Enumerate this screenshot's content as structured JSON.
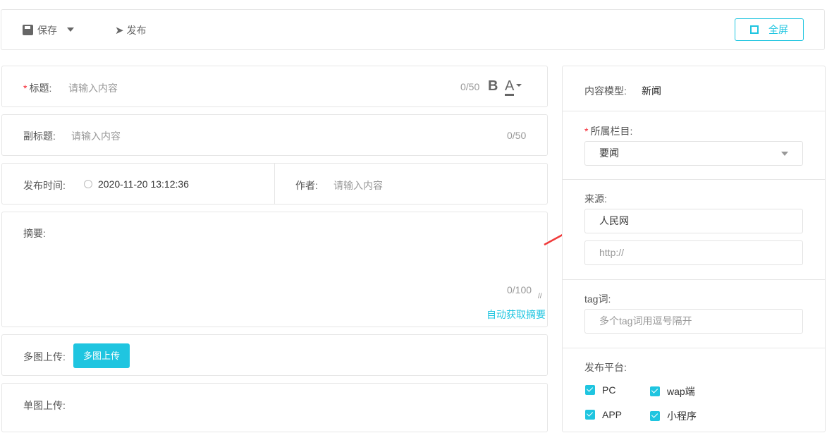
{
  "toolbar": {
    "save": "保存",
    "publish": "发布",
    "fullscreen": "全屏"
  },
  "title": {
    "label": "标题:",
    "placeholder": "请输入内容",
    "count": "0/50",
    "bold": "B",
    "color": "A"
  },
  "subtitle": {
    "label": "副标题:",
    "placeholder": "请输入内容",
    "count": "0/50"
  },
  "publish_time": {
    "label": "发布时间:",
    "value": "2020-11-20 13:12:36"
  },
  "author": {
    "label": "作者:",
    "placeholder": "请输入内容"
  },
  "summary": {
    "label": "摘要:",
    "count": "0/100",
    "auto_link": "自动获取摘要"
  },
  "multi_upload": {
    "label": "多图上传:",
    "button": "多图上传"
  },
  "single_upload": {
    "label": "单图上传:"
  },
  "side": {
    "model_label": "内容模型:",
    "model_value": "新闻",
    "column_label": "所属栏目:",
    "column_value": "要闻",
    "source_label": "来源:",
    "source_value": "人民网",
    "source_url_placeholder": "http://",
    "tag_label": "tag词:",
    "tag_placeholder": "多个tag词用逗号隔开",
    "platform_label": "发布平台:",
    "platforms": [
      {
        "label": "PC",
        "checked": true
      },
      {
        "label": "wap端",
        "checked": true
      },
      {
        "label": "APP",
        "checked": true
      },
      {
        "label": "小程序",
        "checked": true
      }
    ]
  },
  "accent": "#1fc5e0"
}
